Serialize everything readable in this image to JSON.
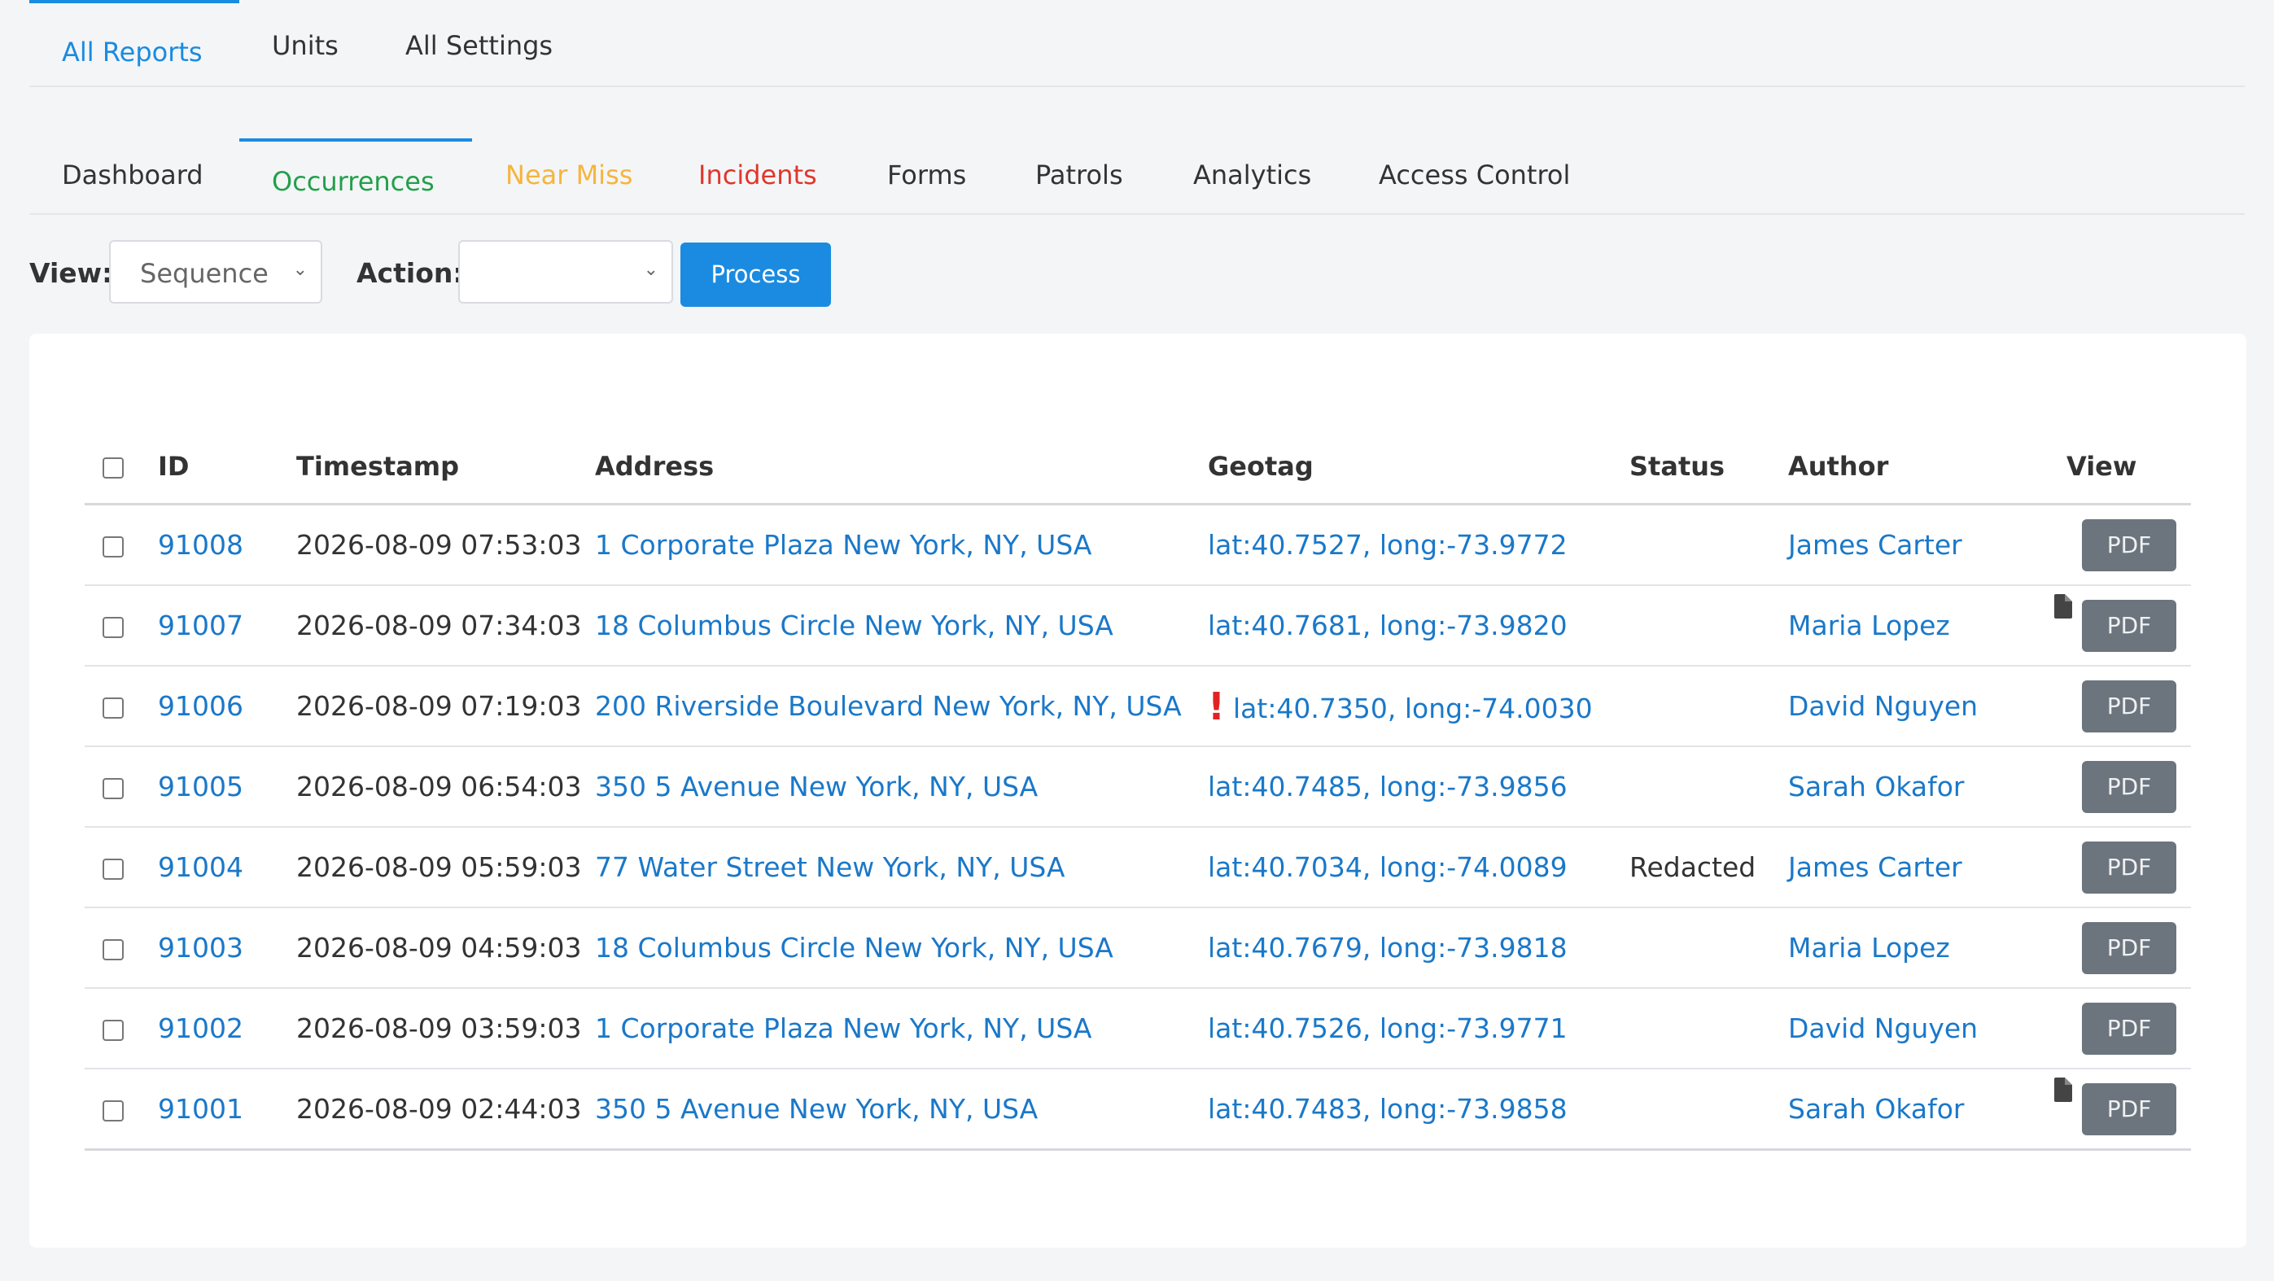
{
  "top_tabs": [
    {
      "label": "All Reports",
      "active": true
    },
    {
      "label": "Units",
      "active": false
    },
    {
      "label": "All Settings",
      "active": false
    }
  ],
  "sub_tabs": [
    {
      "label": "Dashboard",
      "color": "#333333"
    },
    {
      "label": "Occurrences",
      "color": "#22a04a",
      "active": true
    },
    {
      "label": "Near Miss",
      "color": "#f5b53d"
    },
    {
      "label": "Incidents",
      "color": "#e0362c"
    },
    {
      "label": "Forms",
      "color": "#333333"
    },
    {
      "label": "Patrols",
      "color": "#333333"
    },
    {
      "label": "Analytics",
      "color": "#333333"
    },
    {
      "label": "Access Control",
      "color": "#333333"
    }
  ],
  "toolbar": {
    "view_label": "View:",
    "view_value": "Sequence",
    "action_label": "Action:",
    "action_value": "",
    "process_label": "Process"
  },
  "table": {
    "columns": [
      "ID",
      "Timestamp",
      "Address",
      "Geotag",
      "Status",
      "Author",
      "View"
    ],
    "pdf_label": "PDF",
    "rows": [
      {
        "id": "91008",
        "timestamp": "2026-08-09 07:53:03",
        "address": "1 Corporate Plaza New York, NY, USA",
        "geotag": "lat:40.7527, long:-73.9772",
        "status": "",
        "author": "James Carter",
        "doc_icon": false,
        "warning": false
      },
      {
        "id": "91007",
        "timestamp": "2026-08-09 07:34:03",
        "address": "18 Columbus Circle New York, NY, USA",
        "geotag": "lat:40.7681, long:-73.9820",
        "status": "",
        "author": "Maria Lopez",
        "doc_icon": true,
        "warning": false
      },
      {
        "id": "91006",
        "timestamp": "2026-08-09 07:19:03",
        "address": "200 Riverside Boulevard New York, NY, USA",
        "geotag": "lat:40.7350, long:-74.0030",
        "status": "",
        "author": "David Nguyen",
        "doc_icon": false,
        "warning": true
      },
      {
        "id": "91005",
        "timestamp": "2026-08-09 06:54:03",
        "address": "350 5 Avenue New York, NY, USA",
        "geotag": "lat:40.7485, long:-73.9856",
        "status": "",
        "author": "Sarah Okafor",
        "doc_icon": false,
        "warning": false
      },
      {
        "id": "91004",
        "timestamp": "2026-08-09 05:59:03",
        "address": "77 Water Street New York, NY, USA",
        "geotag": "lat:40.7034, long:-74.0089",
        "status": "Redacted",
        "author": "James Carter",
        "doc_icon": false,
        "warning": false
      },
      {
        "id": "91003",
        "timestamp": "2026-08-09 04:59:03",
        "address": "18 Columbus Circle New York, NY, USA",
        "geotag": "lat:40.7679, long:-73.9818",
        "status": "",
        "author": "Maria Lopez",
        "doc_icon": false,
        "warning": false
      },
      {
        "id": "91002",
        "timestamp": "2026-08-09 03:59:03",
        "address": "1 Corporate Plaza New York, NY, USA",
        "geotag": "lat:40.7526, long:-73.9771",
        "status": "",
        "author": "David Nguyen",
        "doc_icon": false,
        "warning": false
      },
      {
        "id": "91001",
        "timestamp": "2026-08-09 02:44:03",
        "address": "350 5 Avenue New York, NY, USA",
        "geotag": "lat:40.7483, long:-73.9858",
        "status": "",
        "author": "Sarah Okafor",
        "doc_icon": true,
        "warning": false
      }
    ]
  }
}
